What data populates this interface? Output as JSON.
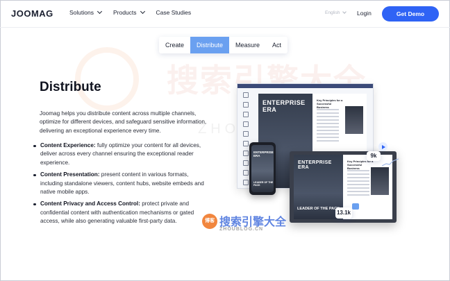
{
  "header": {
    "logo": "JOOMAG",
    "nav": [
      {
        "label": "Solutions",
        "has_dropdown": true
      },
      {
        "label": "Products",
        "has_dropdown": true
      },
      {
        "label": "Case Studies",
        "has_dropdown": false
      }
    ],
    "language": "English",
    "login": "Login",
    "cta": "Get Demo",
    "accent_color": "#2f63f5"
  },
  "tabs": {
    "items": [
      "Create",
      "Distribute",
      "Measure",
      "Act"
    ],
    "active": "Distribute",
    "active_color": "#6aa0f0"
  },
  "main": {
    "title": "Distribute",
    "intro": "Joomag helps you distribute content across multiple channels, optimize for different devices, and safeguard sensitive information, delivering an exceptional experience every time.",
    "bullets": [
      {
        "heading": "Content Experience:",
        "text": " fully optimize your content for all devices, deliver across every channel ensuring the exceptional reader experience."
      },
      {
        "heading": "Content Presentation:",
        "text": " present content in various formats, including standalone viewers, content hubs, website embeds and native mobile apps."
      },
      {
        "heading": "Content Privacy and Access Control:",
        "text": " protect private and confidential content with authentication mechanisms or gated access, while also generating valuable first-party data."
      }
    ]
  },
  "mockup": {
    "magazine_title": "ENTERPRISE ERA",
    "spread_heading": "Key Principles for a Successful Business",
    "cover_line": "LEADER OF THE PACK",
    "stat_views": "9k",
    "stat_reads": "13.1k"
  },
  "watermark": {
    "big": "搜索引擎大全",
    "big_sub": "ZHOUBLOG.CN",
    "badge": "博客",
    "small": "搜索引擎大全",
    "small_sub": "ZHOUBLOG.CN"
  }
}
